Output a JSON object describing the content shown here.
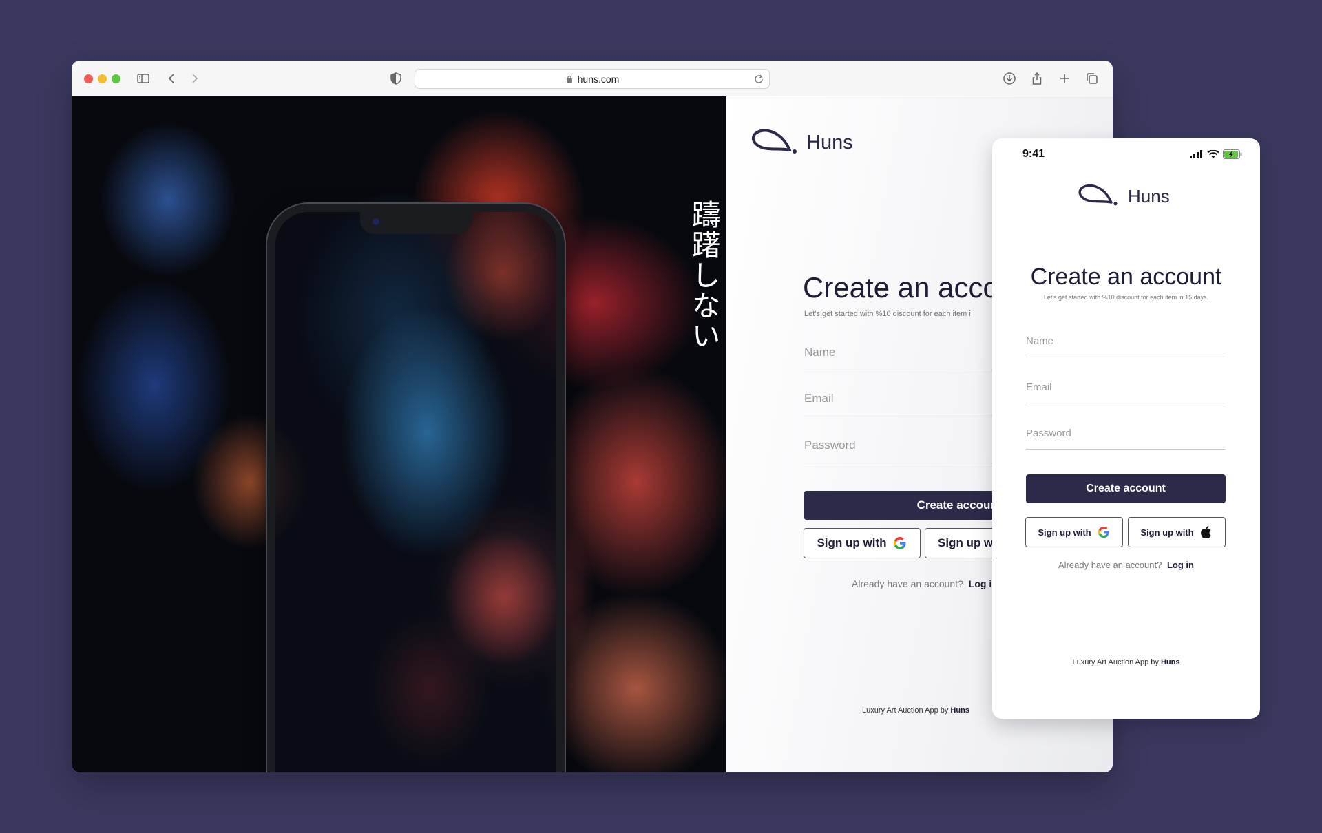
{
  "browser": {
    "url": "huns.com"
  },
  "hero": {
    "vertical_text": "躊躇しない"
  },
  "brand": {
    "name": "Huns",
    "color": "#2b2a48"
  },
  "web_form": {
    "title": "Create an acco",
    "subtitle": "Let's get started with %10 discount for each item i",
    "name_placeholder": "Name",
    "email_placeholder": "Email",
    "password_placeholder": "Password",
    "create_button": "Create account",
    "google_button": "Sign up with",
    "apple_button": "Sign up wi",
    "have_account": "Already have an account?",
    "login_link": "Log in",
    "footer_prefix": "Luxury Art Auction App by ",
    "footer_brand": "Huns"
  },
  "mobile": {
    "time": "9:41",
    "title": "Create an account",
    "subtitle": "Let's get started with %10 discount for each item in 15 days.",
    "name_placeholder": "Name",
    "email_placeholder": "Email",
    "password_placeholder": "Password",
    "create_button": "Create account",
    "google_button": "Sign up with",
    "apple_button": "Sign up with",
    "have_account": "Already have an account?",
    "login_link": "Log in",
    "footer_prefix": "Luxury Art Auction App by ",
    "footer_brand": "Huns"
  }
}
